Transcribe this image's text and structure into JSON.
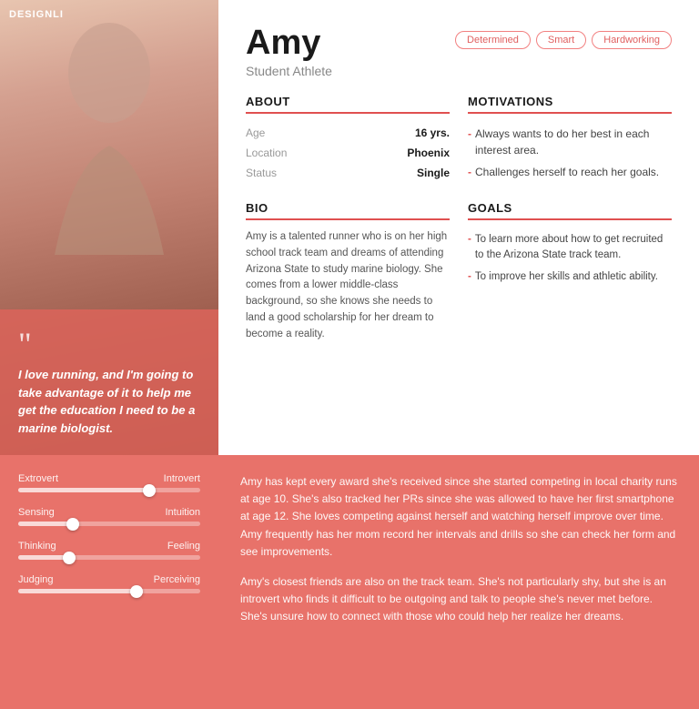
{
  "logo": "DESIGNLI",
  "person": {
    "name": "Amy",
    "role": "Student Athlete",
    "tags": [
      "Determined",
      "Smart",
      "Hardworking"
    ],
    "quote": "I love running, and I'm going to take advantage of it to help me get the education I need to be a marine biologist.",
    "about": {
      "title": "ABOUT",
      "fields": [
        {
          "label": "Age",
          "value": "16 yrs."
        },
        {
          "label": "Location",
          "value": "Phoenix"
        },
        {
          "label": "Status",
          "value": "Single"
        }
      ]
    },
    "motivations": {
      "title": "MOTIVATIONS",
      "items": [
        "Always wants to do her best in each interest area.",
        "Challenges herself to reach her goals."
      ]
    },
    "bio": {
      "title": "BIO",
      "text": "Amy is a talented runner who is on her high school track team and dreams of attending Arizona State to study marine biology. She comes from a lower middle-class background, so she knows she needs to land a good scholarship for her dream to become a reality."
    },
    "goals": {
      "title": "GOALS",
      "items": [
        "To learn more about how to get recruited to the Arizona State track team.",
        "To improve her skills and athletic ability."
      ]
    },
    "personality": {
      "paragraph1": "Amy has kept every award she's received since she started competing in local charity runs at age 10. She's also tracked her PRs since she was allowed to have her first smartphone at age 12. She loves competing against herself and watching herself improve over time. Amy frequently has her mom record her intervals and drills so she can check her form and see improvements.",
      "paragraph2": "Amy's closest friends are also on the track team. She's not particularly shy, but she is an introvert who finds it difficult to be outgoing and talk to people she's never met before. She's unsure how to connect with those who could help her realize her dreams."
    },
    "mbti": {
      "sliders": [
        {
          "left": "Extrovert",
          "right": "Introvert",
          "position": 72
        },
        {
          "left": "Sensing",
          "right": "Intuition",
          "position": 30
        },
        {
          "left": "Thinking",
          "right": "Feeling",
          "position": 28
        },
        {
          "left": "Judging",
          "right": "Perceiving",
          "position": 65
        }
      ]
    }
  },
  "colors": {
    "accent": "#e05050",
    "bottom_bg": "#e8726a",
    "tag_border": "#f28080",
    "tag_text": "#e06060"
  }
}
